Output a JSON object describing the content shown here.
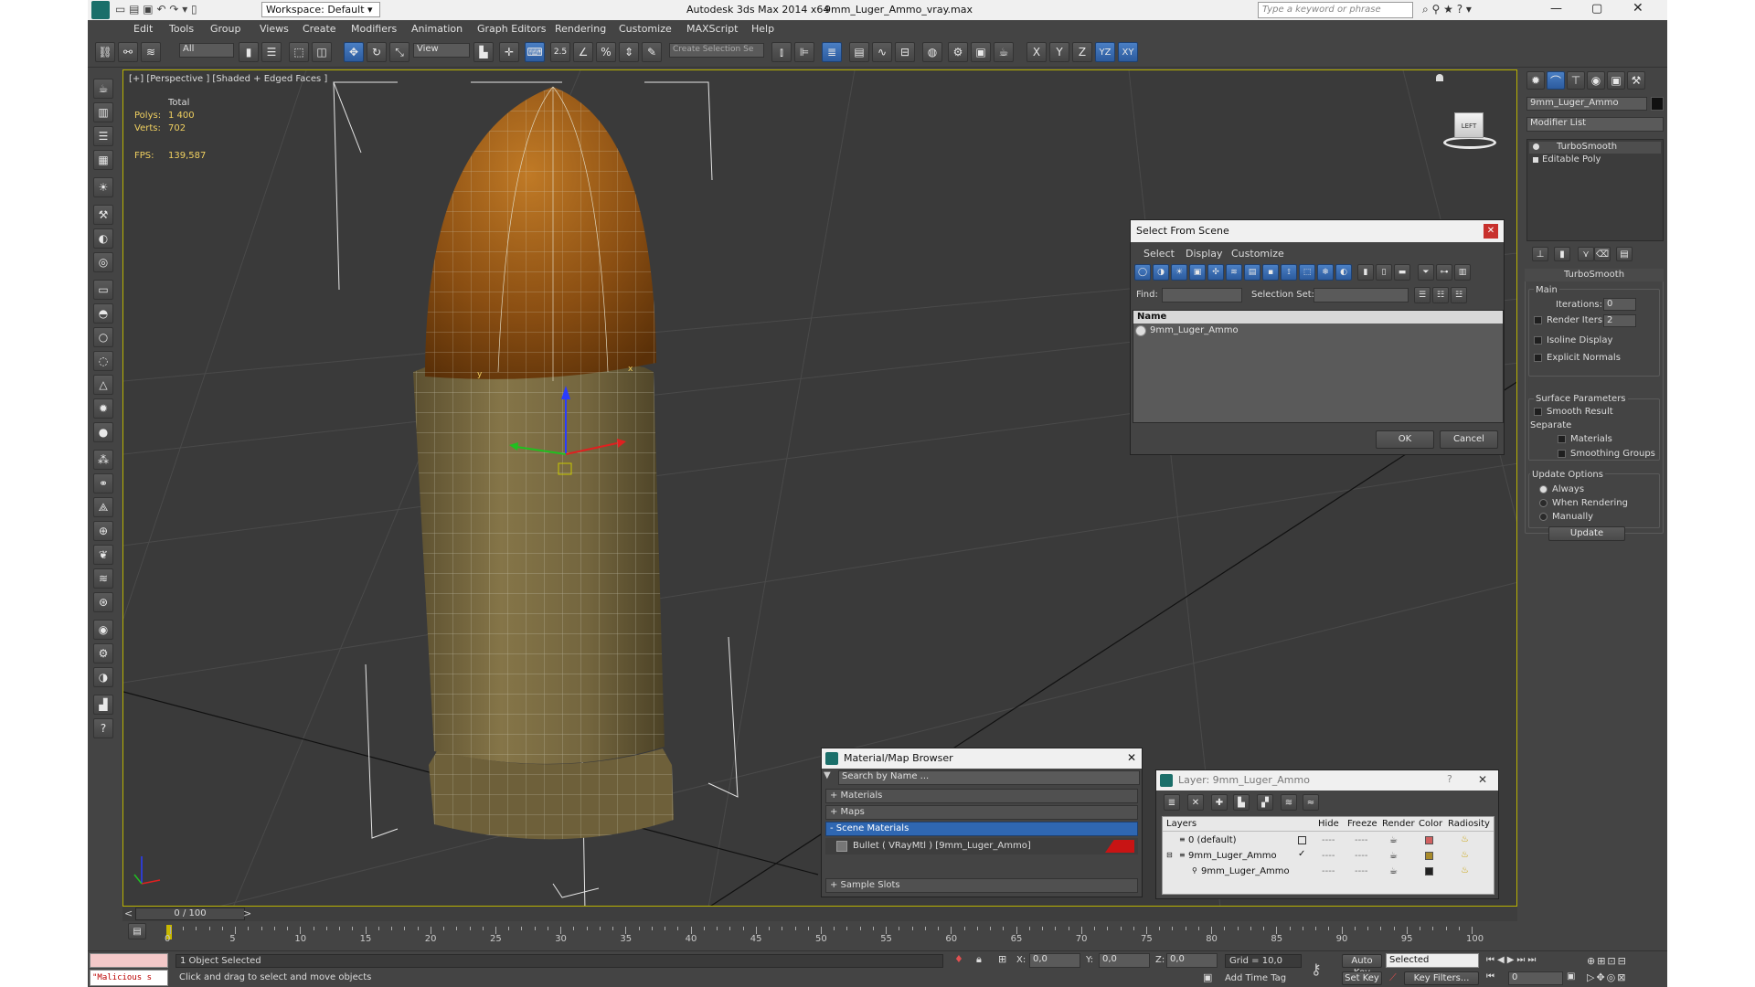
{
  "titlebar": {
    "workspace": "Workspace: Default",
    "app_title": "Autodesk 3ds Max  2014 x64",
    "file_name": "9mm_Luger_Ammo_vray.max",
    "search_placeholder": "Type a keyword or phrase"
  },
  "menu": [
    "Edit",
    "Tools",
    "Group",
    "Views",
    "Create",
    "Modifiers",
    "Animation",
    "Graph Editors",
    "Rendering",
    "Customize",
    "MAXScript",
    "Help"
  ],
  "toolbar": {
    "filter_all": "All",
    "ref_coord": "View",
    "snap_value": "2.5",
    "selection_set_placeholder": "Create Selection Se",
    "axis_x": "X",
    "axis_y": "Y",
    "axis_z": "Z",
    "axis_yz": "YZ",
    "axis_xy": "XY"
  },
  "viewport": {
    "label": "[+] [Perspective ] [Shaded + Edged Faces ]",
    "stats_total": "Total",
    "polys_label": "Polys:",
    "polys_value": "1 400",
    "verts_label": "Verts:",
    "verts_value": "702",
    "fps_label": "FPS:",
    "fps_value": "139,587",
    "viewcube_label": "LEFT",
    "gizmo_y": "y",
    "gizmo_x": "x"
  },
  "command_panel": {
    "object_name": "9mm_Luger_Ammo",
    "modifier_list": "Modifier List",
    "stack": [
      "TurboSmooth",
      "Editable Poly"
    ],
    "rollout_title": "TurboSmooth",
    "main_group": "Main",
    "iterations_label": "Iterations:",
    "iterations_value": "0",
    "render_iters_label": "Render Iters:",
    "render_iters_value": "2",
    "isoline": "Isoline Display",
    "explicit_normals": "Explicit Normals",
    "surface_params": "Surface Parameters",
    "smooth_result": "Smooth Result",
    "separate": "Separate",
    "materials": "Materials",
    "smoothing_groups": "Smoothing Groups",
    "update_options": "Update Options",
    "always": "Always",
    "when_rendering": "When Rendering",
    "manually": "Manually",
    "update_button": "Update"
  },
  "select_dialog": {
    "title": "Select From Scene",
    "menu": [
      "Select",
      "Display",
      "Customize"
    ],
    "find_label": "Find:",
    "selection_set_label": "Selection Set:",
    "column_name": "Name",
    "items": [
      "9mm_Luger_Ammo"
    ],
    "ok": "OK",
    "cancel": "Cancel"
  },
  "material_browser": {
    "title": "Material/Map Browser",
    "search_placeholder": "Search by Name ...",
    "sections": [
      "+ Materials",
      "+ Maps",
      "- Scene Materials",
      "+ Sample Slots"
    ],
    "scene_material": "Bullet  ( VRayMtl ) [9mm_Luger_Ammo]",
    "swatch_color": "#c81414"
  },
  "layer_dialog": {
    "title": "Layer: 9mm_Luger_Ammo",
    "help": "?",
    "columns": [
      "Layers",
      "Hide",
      "Freeze",
      "Render",
      "Color",
      "Radiosity"
    ],
    "rows": [
      {
        "name": "0 (default)",
        "hide": "----",
        "freeze": "----",
        "color": "#d06060"
      },
      {
        "name": "9mm_Luger_Ammo",
        "hide": "----",
        "freeze": "----",
        "color": "#a88a2a"
      },
      {
        "name": "9mm_Luger_Ammo",
        "hide": "----",
        "freeze": "----",
        "color": "#222222"
      }
    ]
  },
  "timeline": {
    "frame_counter": "0 / 100",
    "prev": "<",
    "next": ">",
    "ticks": [
      "0",
      "5",
      "10",
      "15",
      "20",
      "25",
      "30",
      "35",
      "40",
      "45",
      "50",
      "55",
      "60",
      "65",
      "70",
      "75",
      "80",
      "85",
      "90",
      "95",
      "100"
    ]
  },
  "status": {
    "maxscript_listener": "\"Malicious s",
    "selection": "1 Object Selected",
    "prompt": "Click and drag to select and move objects",
    "x_label": "X:",
    "x_value": "0,0",
    "y_label": "Y:",
    "y_value": "0,0",
    "z_label": "Z:",
    "z_value": "0,0",
    "grid": "Grid = 10,0",
    "add_time_tag": "Add Time Tag",
    "auto_key": "Auto Key",
    "selected": "Selected",
    "set_key": "Set Key",
    "key_filters": "Key Filters...",
    "frame_value": "0"
  },
  "colors": {
    "accent_blue": "#2f67b2",
    "viewport_border": "#b9b200",
    "bullet_tip": "#8a4a10",
    "bullet_case": "#7a6a42"
  }
}
